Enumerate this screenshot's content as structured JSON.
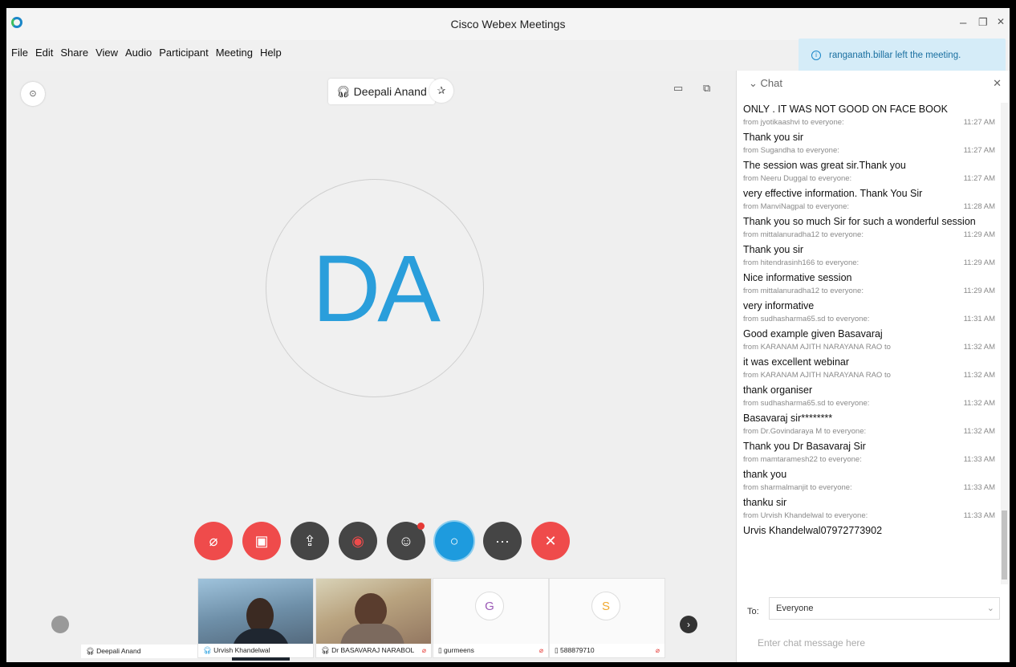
{
  "window": {
    "title": "Cisco Webex Meetings",
    "minimize": "–",
    "restore": "❐",
    "close": "✕"
  },
  "menu": [
    "File",
    "Edit",
    "Share",
    "View",
    "Audio",
    "Participant",
    "Meeting",
    "Help"
  ],
  "notification": "ranganath.billar left the meeting.",
  "stage": {
    "active_speaker": "Deepali Anand",
    "avatar_initials": "DA"
  },
  "controls": [
    "mute",
    "stop-video",
    "share",
    "record",
    "participants",
    "chat",
    "more",
    "leave"
  ],
  "filmstrip": [
    {
      "name": "Deepali Anand",
      "initial": ""
    },
    {
      "name": "Urvish Khandelwal",
      "initial": ""
    },
    {
      "name": "Dr BASAVARAJ NARABOL",
      "initial": ""
    },
    {
      "name": "gurmeens",
      "initial": "G"
    },
    {
      "name": "588879710",
      "initial": "S"
    }
  ],
  "chat": {
    "title": "Chat",
    "messages": [
      {
        "text": "ONLY . IT WAS NOT GOOD ON FACE BOOK",
        "from": "from jyotikaashvi to everyone:",
        "time": "11:27 AM"
      },
      {
        "text": "Thank you sir",
        "from": "from Sugandha to everyone:",
        "time": "11:27 AM"
      },
      {
        "text": "The session was great sir.Thank you",
        "from": "from Neeru Duggal to everyone:",
        "time": "11:27 AM"
      },
      {
        "text": "very effective information. Thank You Sir",
        "from": "from ManviNagpal to everyone:",
        "time": "11:28 AM"
      },
      {
        "text": "Thank you so much Sir for such a wonderful session",
        "from": "from mittalanuradha12 to everyone:",
        "time": "11:29 AM"
      },
      {
        "text": "Thank you sir",
        "from": "from hitendrasinh166 to everyone:",
        "time": "11:29 AM"
      },
      {
        "text": "Nice informative session",
        "from": "from mittalanuradha12 to everyone:",
        "time": "11:29 AM"
      },
      {
        "text": "very informative",
        "from": "from sudhasharma65.sd to everyone:",
        "time": "11:31 AM"
      },
      {
        "text": "Good example given  Basavaraj",
        "from": "from KARANAM AJITH NARAYANA RAO to",
        "time": "11:32 AM"
      },
      {
        "text": "it was excellent webinar",
        "from": "from KARANAM AJITH NARAYANA RAO to",
        "time": "11:32 AM"
      },
      {
        "text": "thank organiser",
        "from": "from sudhasharma65.sd to everyone:",
        "time": "11:32 AM"
      },
      {
        "text": "Basavaraj sir********",
        "from": "from Dr.Govindaraya M to everyone:",
        "time": "11:32 AM"
      },
      {
        "text": "Thank you Dr Basavaraj Sir",
        "from": "from mamtaramesh22 to everyone:",
        "time": "11:33 AM"
      },
      {
        "text": "thank you",
        "from": "from sharmalmanjit to everyone:",
        "time": "11:33 AM"
      },
      {
        "text": "thanku sir",
        "from": "from Urvish Khandelwal to everyone:",
        "time": "11:33 AM"
      }
    ],
    "last_text": "Urvis Khandelwal07972773902",
    "to_label": "To:",
    "to_value": "Everyone",
    "input_placeholder": "Enter chat message here"
  },
  "colors": {
    "accent_blue": "#1e9bde",
    "danger_red": "#ef4b4b",
    "notification_bg": "#d5ecf8"
  }
}
